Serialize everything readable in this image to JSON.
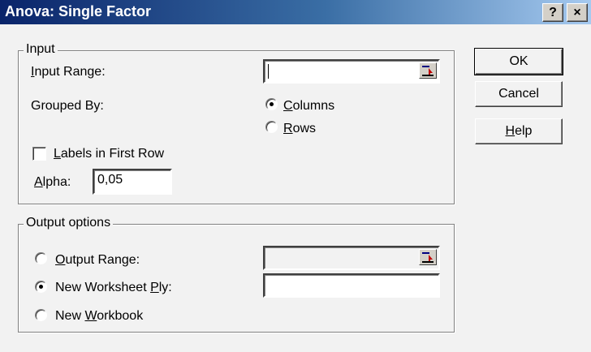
{
  "window": {
    "title": "Anova: Single Factor",
    "help_btn": "?",
    "close_btn": "×"
  },
  "input_group": {
    "legend": "Input",
    "input_range": {
      "pre": "",
      "accel": "I",
      "post": "nput Range:",
      "value": ""
    },
    "grouped_by_label": "Grouped By:",
    "columns": {
      "pre": "",
      "accel": "C",
      "post": "olumns",
      "selected": true
    },
    "rows": {
      "pre": "",
      "accel": "R",
      "post": "ows",
      "selected": false
    },
    "labels_first_row": {
      "pre": "",
      "accel": "L",
      "post": "abels in First Row",
      "checked": false
    },
    "alpha": {
      "pre": "",
      "accel": "A",
      "post": "lpha:",
      "value": "0,05"
    }
  },
  "output_group": {
    "legend": "Output options",
    "output_range": {
      "pre": "",
      "accel": "O",
      "post": "utput Range:",
      "selected": false,
      "value": ""
    },
    "new_worksheet": {
      "pre": "New Worksheet ",
      "accel": "P",
      "post": "ly:",
      "selected": true,
      "value": ""
    },
    "new_workbook": {
      "pre": "New ",
      "accel": "W",
      "post": "orkbook",
      "selected": false
    }
  },
  "buttons": {
    "ok": "OK",
    "cancel": "Cancel",
    "help": {
      "pre": "",
      "accel": "H",
      "post": "elp"
    }
  }
}
